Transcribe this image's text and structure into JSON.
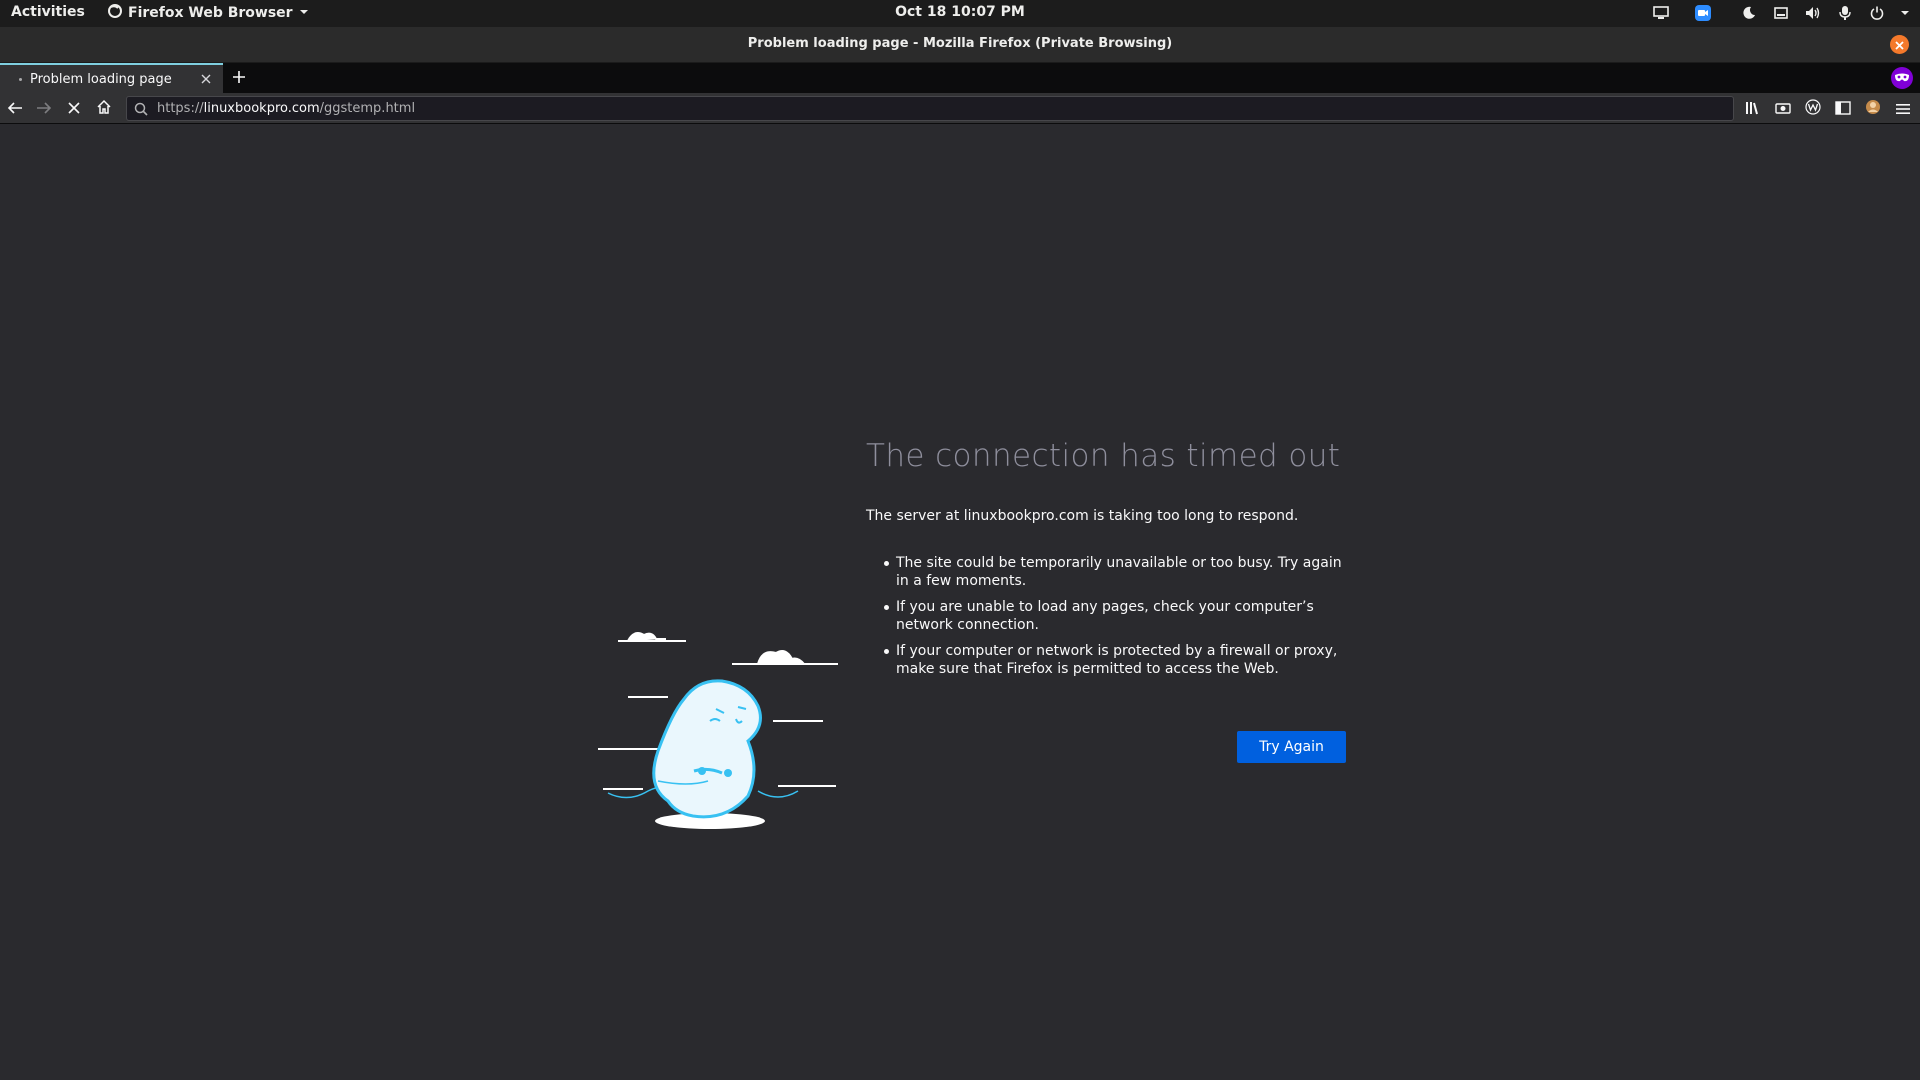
{
  "topbar": {
    "activities": "Activities",
    "app_name": "Firefox Web Browser",
    "clock": "Oct 18  10:07 PM"
  },
  "window": {
    "title": "Problem loading page - Mozilla Firefox (Private Browsing)"
  },
  "tabs": [
    {
      "label": "Problem loading page",
      "active": true
    }
  ],
  "urlbar": {
    "scheme": "https://",
    "host": "linuxbookpro.com",
    "path": "/ggstemp.html"
  },
  "error": {
    "title": "The connection has timed out",
    "lead": "The server at linuxbookpro.com is taking too long to respond.",
    "bullets": [
      "The site could be temporarily unavailable or too busy. Try again in a few moments.",
      "If you are unable to load any pages, check your computer’s network connection.",
      "If your computer or network is protected by a firewall or proxy, make sure that Firefox is permitted to access the Web."
    ],
    "button": "Try Again"
  },
  "icons": {
    "tray": [
      "screen-share-icon",
      "zoom-icon",
      "night-light-icon",
      "keyboard-icon",
      "volume-icon",
      "microphone-icon",
      "power-icon",
      "chevron-down-icon"
    ],
    "toolbar": [
      "library-icon",
      "screenshot-icon",
      "extension-w-icon",
      "sidebar-icon",
      "account-icon",
      "hamburger-menu-icon"
    ]
  },
  "colors": {
    "accent": "#0060df",
    "private": "#8000d7",
    "tab_highlight": "#7fcfe0",
    "window_close": "#f4792b"
  }
}
